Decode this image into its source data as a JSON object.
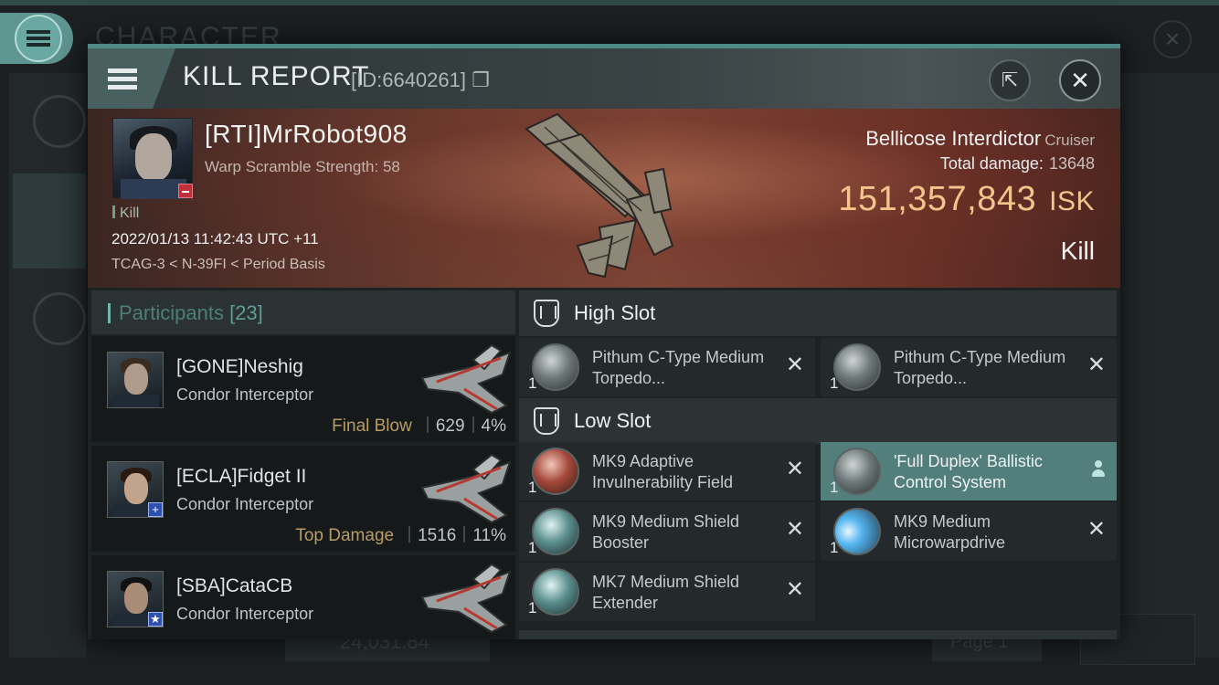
{
  "background": {
    "title": "CHARACTER",
    "balance": "24,031.84",
    "page_label": "Page 1"
  },
  "header": {
    "title": "KILL REPORT",
    "id": "[ID:6640261]"
  },
  "victim": {
    "name": "[RTI]MrRobot908",
    "subtitle": "Warp Scramble Strength: 58",
    "kill_tag": "Kill",
    "date": "2022/01/13 11:42:43 UTC +11",
    "location": "TCAG-3 < N-39FI < Period Basis",
    "ship_name": "Bellicose Interdictor",
    "ship_class": "Cruiser",
    "damage_label": "Total damage:",
    "damage_value": "13648",
    "isk_value": "151,357,843",
    "isk_unit": "ISK",
    "result": "Kill"
  },
  "participants": {
    "label": "Participants",
    "count": "[23]",
    "rows": [
      {
        "name": "[GONE]Neshig",
        "ship": "Condor Interceptor",
        "tag": "Final Blow",
        "damage": "629",
        "percent": "4%",
        "badge": ""
      },
      {
        "name": "[ECLA]Fidget II",
        "ship": "Condor Interceptor",
        "tag": "Top Damage",
        "damage": "1516",
        "percent": "11%",
        "badge": "+"
      },
      {
        "name": "[SBA]CataCB",
        "ship": "Condor Interceptor",
        "tag": "",
        "damage": "",
        "percent": "",
        "badge": "★"
      }
    ]
  },
  "fitting": {
    "high_slot_label": "High Slot",
    "low_slot_label": "Low Slot",
    "high": [
      {
        "name": "Pithum C-Type Medium Torpedo...",
        "qty": "1",
        "icon": "grey"
      },
      {
        "name": "Pithum C-Type Medium Torpedo...",
        "qty": "1",
        "icon": "grey"
      }
    ],
    "low": [
      {
        "name": "MK9 Adaptive Invulnerability Field",
        "qty": "1",
        "icon": "red"
      },
      {
        "name": "'Full Duplex' Ballistic Control System",
        "qty": "1",
        "icon": "grey",
        "highlight": true
      },
      {
        "name": "MK9 Medium Shield Booster",
        "qty": "1",
        "icon": "teal"
      },
      {
        "name": "MK9 Medium Microwarpdrive",
        "qty": "1",
        "icon": "blue"
      },
      {
        "name": "MK7 Medium Shield Extender",
        "qty": "1",
        "icon": "teal"
      }
    ]
  }
}
